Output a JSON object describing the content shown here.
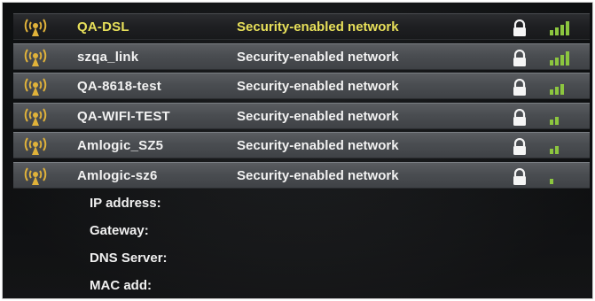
{
  "networks": [
    {
      "ssid": "QA-DSL",
      "security": "Security-enabled network",
      "selected": true,
      "signal": 4,
      "icon": "wifi-icon"
    },
    {
      "ssid": "szqa_link",
      "security": "Security-enabled network",
      "selected": false,
      "signal": 4,
      "icon": "wifi-icon"
    },
    {
      "ssid": "QA-8618-test",
      "security": "Security-enabled network",
      "selected": false,
      "signal": 3,
      "icon": "wifi-icon"
    },
    {
      "ssid": "QA-WIFI-TEST",
      "security": "Security-enabled network",
      "selected": false,
      "signal": 2,
      "icon": "wifi-icon"
    },
    {
      "ssid": "Amlogic_SZ5",
      "security": "Security-enabled network",
      "selected": false,
      "signal": 2,
      "icon": "wifi-icon"
    },
    {
      "ssid": "Amlogic-sz6",
      "security": "Security-enabled network",
      "selected": false,
      "signal": 1,
      "icon": "wifi-icon"
    }
  ],
  "details": {
    "ip_label": "IP address:",
    "gateway_label": "Gateway:",
    "dns_label": "DNS Server:",
    "mac_label": "MAC add:"
  },
  "colors": {
    "selected_text": "#e8e05a",
    "text": "#f2f2f2",
    "wifi_icon": "#e0b23a",
    "signal_bars": "#8cc63f",
    "lock": "#f5f5f5"
  }
}
